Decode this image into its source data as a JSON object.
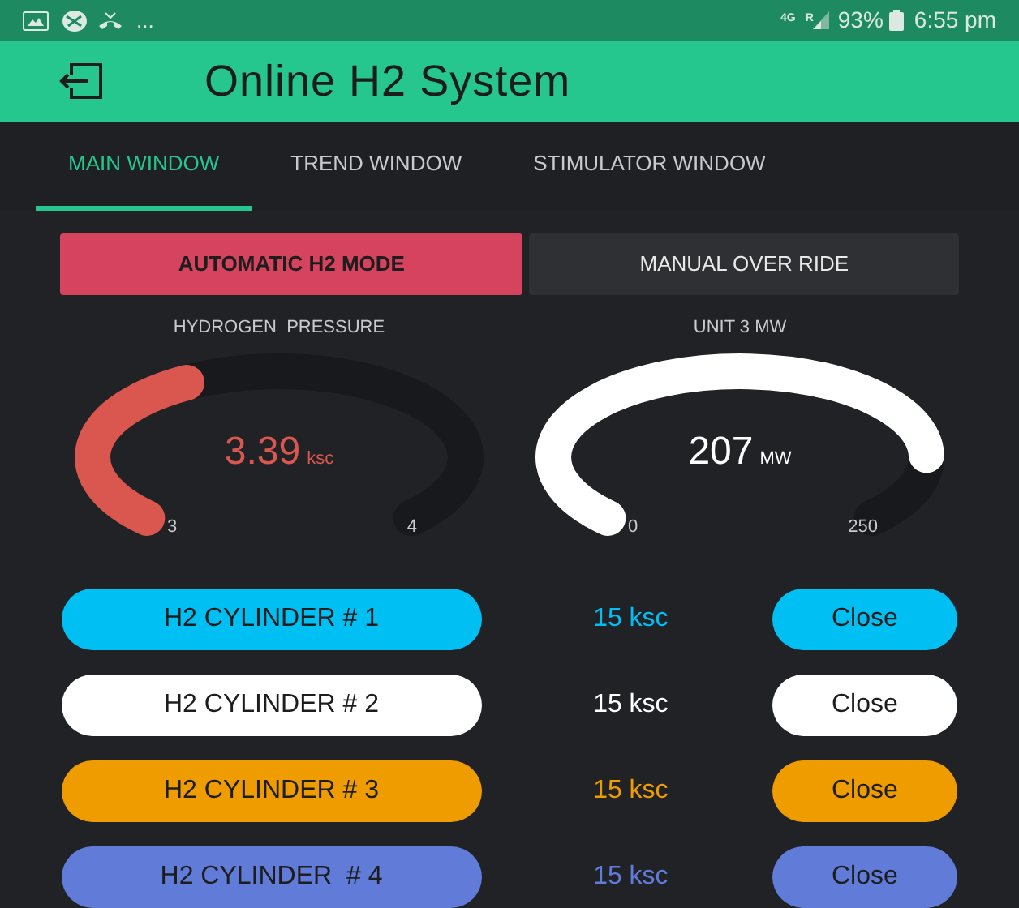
{
  "status_bar": {
    "more": "...",
    "network": "4G",
    "roaming": "R",
    "battery": "93%",
    "time": "6:55 pm"
  },
  "app_bar": {
    "title": "Online H2 System"
  },
  "tabs": [
    {
      "label": "MAIN WINDOW",
      "selected": true
    },
    {
      "label": "TREND WINDOW",
      "selected": false
    },
    {
      "label": "STIMULATOR WINDOW",
      "selected": false
    }
  ],
  "modes": [
    {
      "label": "AUTOMATIC H2 MODE",
      "selected": true
    },
    {
      "label": "MANUAL OVER RIDE",
      "selected": false
    }
  ],
  "gauges": [
    {
      "label": "HYDROGEN  PRESSURE",
      "value": "3.39",
      "unit": "ksc",
      "min": "3",
      "max": "4",
      "color": "#d9574f"
    },
    {
      "label": "UNIT 3 MW",
      "value": "207",
      "unit": "MW",
      "min": "0",
      "max": "250",
      "color": "#ffffff"
    }
  ],
  "cylinders": [
    {
      "name": "H2 CYLINDER # 1",
      "reading": "15 ksc",
      "action": "Close",
      "color": "#00bff3"
    },
    {
      "name": "H2 CYLINDER # 2",
      "reading": "15 ksc",
      "action": "Close",
      "color": "#ffffff"
    },
    {
      "name": "H2 CYLINDER # 3",
      "reading": "15 ksc",
      "action": "Close",
      "color": "#ee9c00"
    },
    {
      "name": "H2 CYLINDER  # 4",
      "reading": "15 ksc",
      "action": "Close",
      "color": "#617bd8"
    }
  ]
}
